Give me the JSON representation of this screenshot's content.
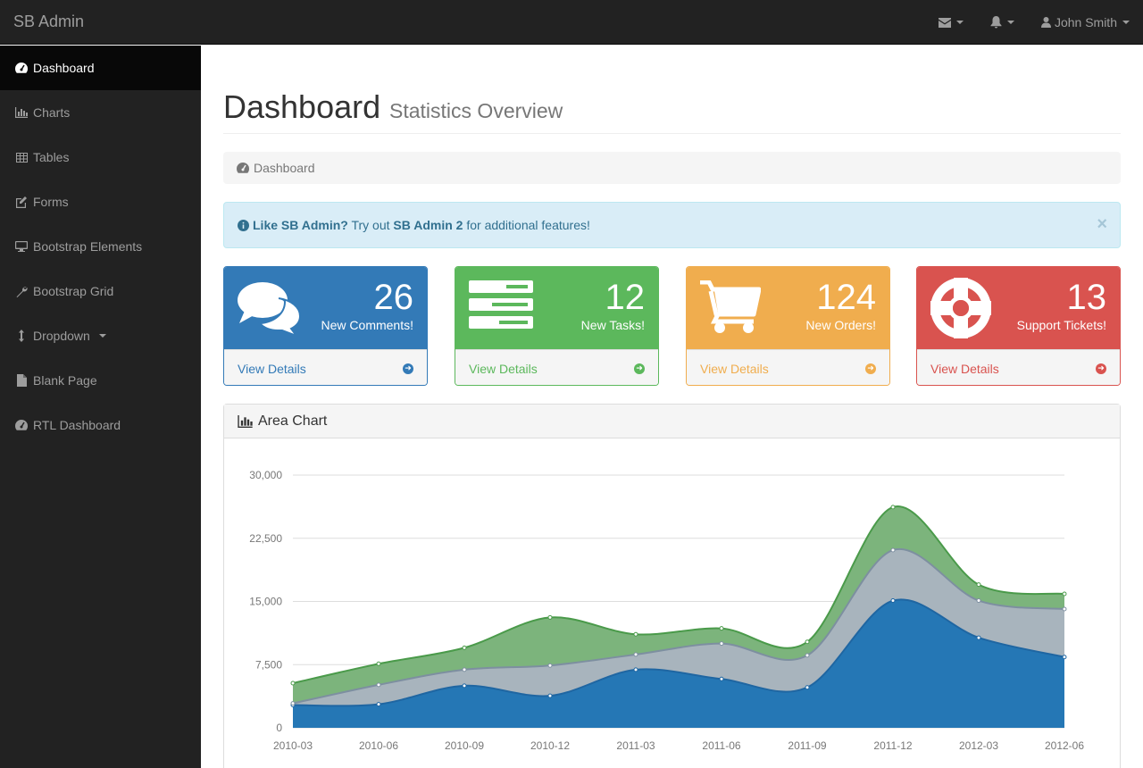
{
  "app": {
    "brand": "SB Admin"
  },
  "topnav": {
    "user": "John Smith"
  },
  "sidebar": {
    "items": [
      {
        "label": "Dashboard"
      },
      {
        "label": "Charts"
      },
      {
        "label": "Tables"
      },
      {
        "label": "Forms"
      },
      {
        "label": "Bootstrap Elements"
      },
      {
        "label": "Bootstrap Grid"
      },
      {
        "label": "Dropdown"
      },
      {
        "label": "Blank Page"
      },
      {
        "label": "RTL Dashboard"
      }
    ]
  },
  "page": {
    "title": "Dashboard",
    "subtitle": "Statistics Overview",
    "breadcrumb": "Dashboard"
  },
  "alert": {
    "strong": "Like SB Admin?",
    "text1": " Try out ",
    "link": "SB Admin 2",
    "text2": " for additional features!",
    "close": "×"
  },
  "cards": [
    {
      "count": "26",
      "label": "New Comments!",
      "link": "View Details",
      "color": "#337ab7"
    },
    {
      "count": "12",
      "label": "New Tasks!",
      "link": "View Details",
      "color": "#5cb85c"
    },
    {
      "count": "124",
      "label": "New Orders!",
      "link": "View Details",
      "color": "#f0ad4e"
    },
    {
      "count": "13",
      "label": "Support Tickets!",
      "link": "View Details",
      "color": "#d9534f"
    }
  ],
  "area_panel": {
    "title": "Area Chart"
  },
  "chart_data": {
    "type": "area",
    "stacked": true,
    "x": [
      "2010-03",
      "2010-06",
      "2010-09",
      "2010-12",
      "2011-03",
      "2011-06",
      "2011-09",
      "2011-12",
      "2012-03",
      "2012-06"
    ],
    "series": [
      {
        "values": [
          2700,
          2800,
          5000,
          3800,
          6900,
          5800,
          4800,
          15100,
          10700,
          8400
        ],
        "color": "#2577b5"
      },
      {
        "values": [
          200,
          2300,
          1900,
          3600,
          1800,
          4200,
          3800,
          6000,
          4400,
          5700
        ],
        "color": "#a8b4bd"
      },
      {
        "values": [
          2400,
          2500,
          2600,
          5700,
          2400,
          1800,
          1600,
          5100,
          1900,
          1800
        ],
        "color": "#7cb47c"
      }
    ],
    "yticks": [
      "0",
      "7,500",
      "15,000",
      "22,500",
      "30,000"
    ],
    "ylim": [
      0,
      30000
    ],
    "grid": true
  }
}
